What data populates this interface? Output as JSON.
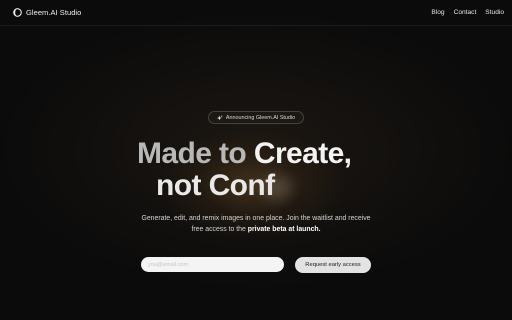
{
  "header": {
    "brand": "Gleem.AI Studio",
    "nav": [
      "Blog",
      "Contact",
      "Studio"
    ]
  },
  "announcement": {
    "text": "Announcing Gleem.AI Studio",
    "icon": "sparkle-icon"
  },
  "hero": {
    "line1_muted": "Made to",
    "line1_strong": "Create,",
    "line2_visible": "not Con",
    "line2_fading": "f"
  },
  "subtitle": {
    "text_line1": "Generate, edit, and remix images in one place. Join the waitlist and receive",
    "text_line2_plain": "free access to the",
    "text_line2_bold": "private beta at launch."
  },
  "form": {
    "email_placeholder": "you@email.com",
    "email_value": "",
    "cta_label": "Request early access"
  },
  "colors": {
    "background": "#0b0b0b",
    "glow": "#d69646",
    "cta_bg": "#e3e3e3",
    "input_bg": "#f4f4f4"
  }
}
